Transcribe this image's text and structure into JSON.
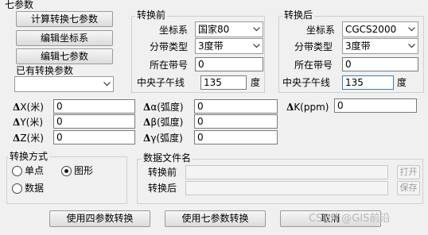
{
  "window": {
    "title": "七参数"
  },
  "left_panel": {
    "calc_button": "计算转换七参数",
    "edit_coords_button": "编辑坐标系",
    "edit_params_button": "编辑七参数",
    "existing_label": "已有转换参数",
    "existing_select": ""
  },
  "before": {
    "title": "转换前",
    "coord_label": "坐标系",
    "coord_value": "国家80",
    "zone_type_label": "分带类型",
    "zone_type_value": "3度带",
    "zone_no_label": "所在带号",
    "zone_no_value": "0",
    "meridian_label": "中央子午线",
    "meridian_value": "135",
    "meridian_unit": "度"
  },
  "after": {
    "title": "转换后",
    "coord_label": "坐标系",
    "coord_value": "CGCS2000",
    "zone_type_label": "分带类型",
    "zone_type_value": "3度带",
    "zone_no_label": "所在带号",
    "zone_no_value": "0",
    "meridian_label": "中央子午线",
    "meridian_value": "135",
    "meridian_unit": "度"
  },
  "params": {
    "dx_label": "X(米)",
    "dx_value": "0",
    "dy_label": "Y(米)",
    "dy_value": "0",
    "dz_label": "Z(米)",
    "dz_value": "0",
    "da_label": "α(弧度)",
    "da_value": "0",
    "db_label": "β(弧度)",
    "db_value": "0",
    "dg_label": "γ(弧度)",
    "dg_value": "0",
    "dk_label": "K(ppm)",
    "dk_value": "0",
    "delta_symbol": "Δ"
  },
  "mode": {
    "title": "转换方式",
    "single_label": "单点",
    "graphic_label": "图形",
    "data_label": "数据",
    "selected": "图形"
  },
  "files": {
    "title": "数据文件名",
    "before_label": "转换前",
    "after_label": "转换后",
    "open_button": "打开",
    "save_button": "保存"
  },
  "footer": {
    "four_param_button": "使用四参数转换",
    "seven_param_button": "使用七参数转换",
    "cancel_button": "取消",
    "watermark": "CSDN @GIS前沿"
  },
  "colors": {
    "window_bg": "#f0f0f0",
    "focus_border": "#3c7fb1"
  }
}
